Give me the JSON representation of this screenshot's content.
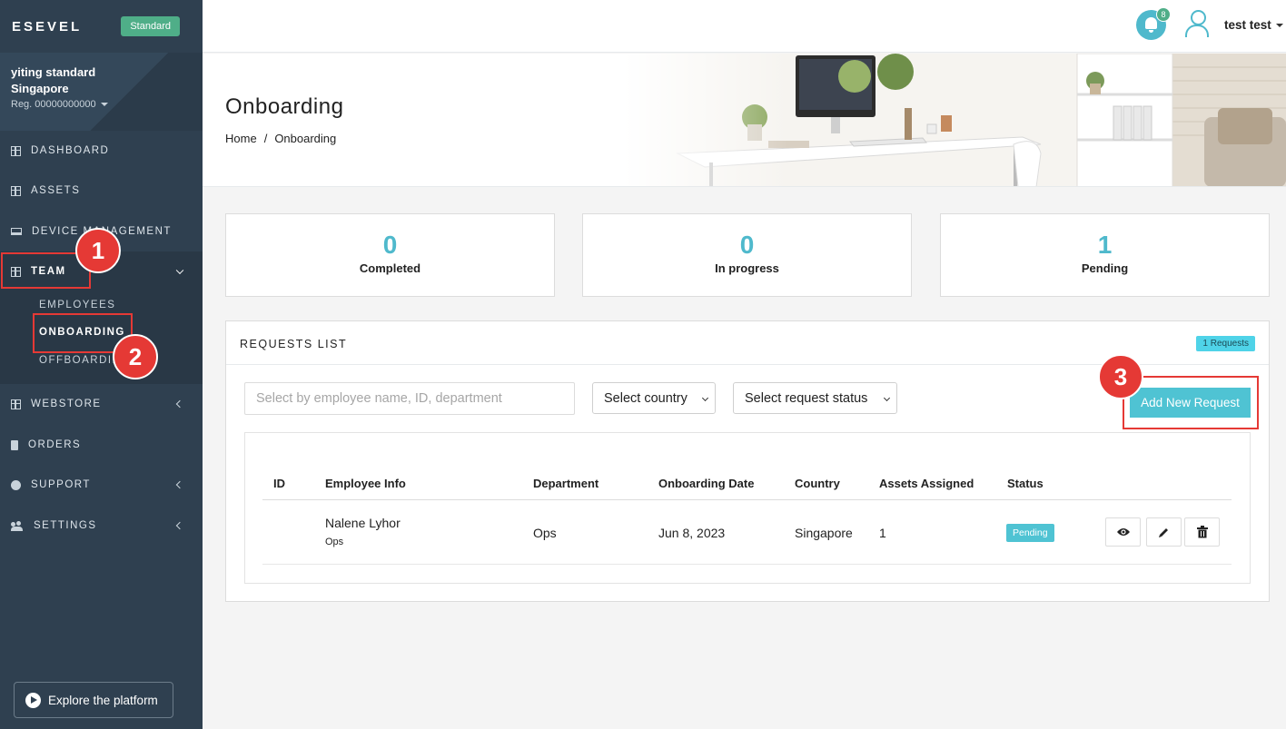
{
  "sidebar": {
    "brand": "ESEVEL",
    "plan": "Standard",
    "company_name": "yiting standard",
    "company_country": "Singapore",
    "company_reg": "Reg. 00000000000",
    "nav": {
      "dashboard": "DASHBOARD",
      "assets": "ASSETS",
      "device_management": "DEVICE MANAGEMENT",
      "team": "TEAM",
      "employees": "EMPLOYEES",
      "onboarding": "ONBOARDING",
      "offboarding": "OFFBOARDING",
      "webstore": "WEBSTORE",
      "orders": "ORDERS",
      "support": "SUPPORT",
      "settings": "SETTINGS"
    },
    "explore": "Explore the platform"
  },
  "annotations": {
    "step1": "1",
    "step2": "2",
    "step3": "3"
  },
  "topbar": {
    "notification_count": "8",
    "user_name": "test test"
  },
  "header": {
    "title": "Onboarding",
    "breadcrumb_home": "Home",
    "breadcrumb_sep": "/",
    "breadcrumb_current": "Onboarding"
  },
  "stats": [
    {
      "value": "0",
      "label": "Completed"
    },
    {
      "value": "0",
      "label": "In progress"
    },
    {
      "value": "1",
      "label": "Pending"
    }
  ],
  "requests": {
    "title": "REQUESTS LIST",
    "count_badge": "1 Requests",
    "search_placeholder": "Select by employee name, ID, department",
    "country_select": "Select country",
    "status_select": "Select request status",
    "add_button": "Add New Request",
    "columns": [
      "ID",
      "Employee Info",
      "Department",
      "Onboarding Date",
      "Country",
      "Assets Assigned",
      "Status"
    ],
    "rows": [
      {
        "id": "",
        "employee_name": "Nalene Lyhor",
        "employee_dept": "Ops",
        "department": "Ops",
        "date": "Jun 8, 2023",
        "country": "Singapore",
        "assets": "1",
        "status": "Pending"
      }
    ]
  },
  "colors": {
    "accent": "#4fb9cc",
    "sidebar": "#2f4050",
    "highlight": "#e53935",
    "plan_badge": "#4fae88"
  }
}
